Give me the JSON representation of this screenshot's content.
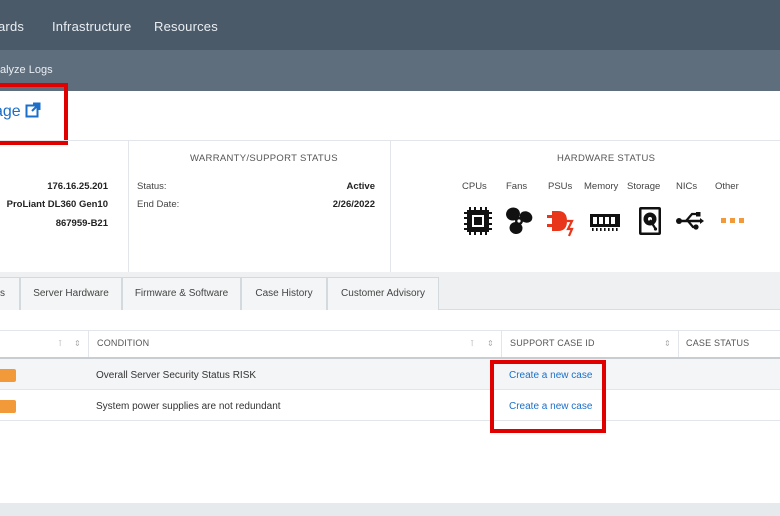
{
  "topnav": {
    "items": [
      "ards",
      "Infrastructure",
      "Resources"
    ]
  },
  "subnav": {
    "analyze_logs": "alyze Logs"
  },
  "launch_link": {
    "label": "age"
  },
  "server_info": {
    "ip": "176.16.25.201",
    "model": "ProLiant DL360 Gen10",
    "part_number": "867959-B21"
  },
  "warranty": {
    "title": "WARRANTY/SUPPORT STATUS",
    "status_label": "Status:",
    "status_value": "Active",
    "end_label": "End Date:",
    "end_value": "2/26/2022"
  },
  "hardware": {
    "title": "HARDWARE STATUS",
    "items": [
      {
        "label": "CPUs",
        "icon": "cpu-icon"
      },
      {
        "label": "Fans",
        "icon": "fan-icon"
      },
      {
        "label": "PSUs",
        "icon": "psu-icon"
      },
      {
        "label": "Memory",
        "icon": "memory-icon"
      },
      {
        "label": "Storage",
        "icon": "storage-icon"
      },
      {
        "label": "NICs",
        "icon": "nic-icon"
      },
      {
        "label": "Other",
        "icon": "other-icon"
      }
    ],
    "colors": {
      "ok": "#111111",
      "warning": "#e8361a",
      "other": "#f29a3a"
    }
  },
  "tabs": [
    "s",
    "Server Hardware",
    "Firmware & Software",
    "Case History",
    "Customer Advisory"
  ],
  "table": {
    "headers": {
      "condition": "CONDITION",
      "support_case_id": "SUPPORT CASE ID",
      "case_status": "CASE STATUS"
    },
    "rows": [
      {
        "condition": "Overall Server Security Status RISK",
        "case_link": "Create a new case",
        "case_status": ""
      },
      {
        "condition": "System power supplies are not redundant",
        "case_link": "Create a new case",
        "case_status": ""
      }
    ]
  },
  "colors": {
    "nav_bg": "#4b5a69",
    "subnav_bg": "#5f6e7d",
    "link": "#1a6fc9",
    "highlight_box": "#e00000",
    "severity_badge": "#f29a3a"
  }
}
